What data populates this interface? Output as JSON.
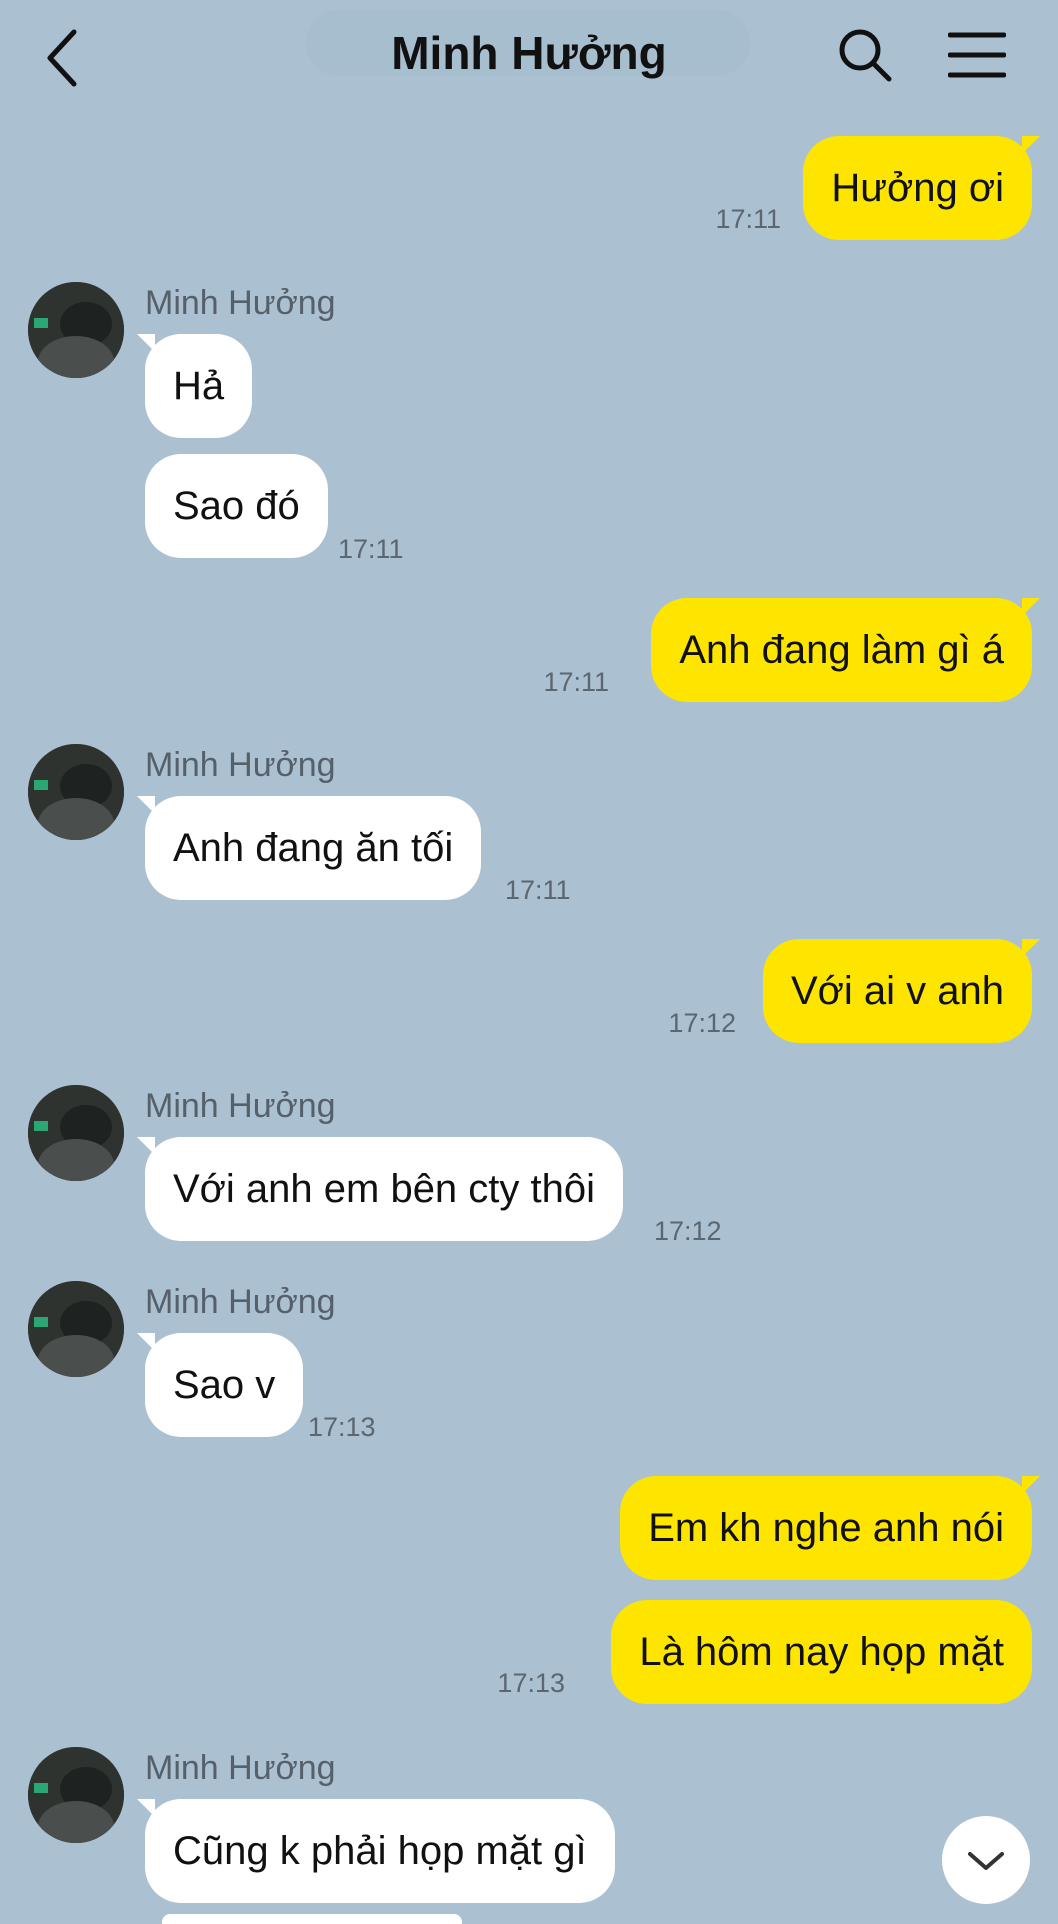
{
  "header": {
    "title": "Minh Hưởng",
    "back_icon": "chevron-left-icon",
    "search_icon": "search-icon",
    "menu_icon": "hamburger-menu-icon"
  },
  "colors": {
    "background": "#abc1d1",
    "incoming_bubble": "#ffffff",
    "outgoing_bubble": "#fde500"
  },
  "messages": [
    {
      "direction": "out",
      "text": "Hưởng ơi",
      "time": "17:11"
    },
    {
      "direction": "in",
      "sender": "Minh Hưởng",
      "text": "Hả"
    },
    {
      "direction": "in",
      "text": "Sao đó",
      "time": "17:11"
    },
    {
      "direction": "out",
      "text": "Anh đang làm gì á",
      "time": "17:11"
    },
    {
      "direction": "in",
      "sender": "Minh Hưởng",
      "text": "Anh đang ăn tối",
      "time": "17:11"
    },
    {
      "direction": "out",
      "text": "Với ai v anh",
      "time": "17:12"
    },
    {
      "direction": "in",
      "sender": "Minh Hưởng",
      "text": "Với anh em bên cty thôi",
      "time": "17:12"
    },
    {
      "direction": "in",
      "sender": "Minh Hưởng",
      "text": "Sao v",
      "time": "17:13"
    },
    {
      "direction": "out",
      "text": "Em kh nghe anh nói"
    },
    {
      "direction": "out",
      "text": "Là hôm nay họp mặt",
      "time": "17:13"
    },
    {
      "direction": "in",
      "sender": "Minh Hưởng",
      "text": "Cũng k phải họp mặt gì"
    }
  ],
  "scroll_down_icon": "chevron-down-icon"
}
